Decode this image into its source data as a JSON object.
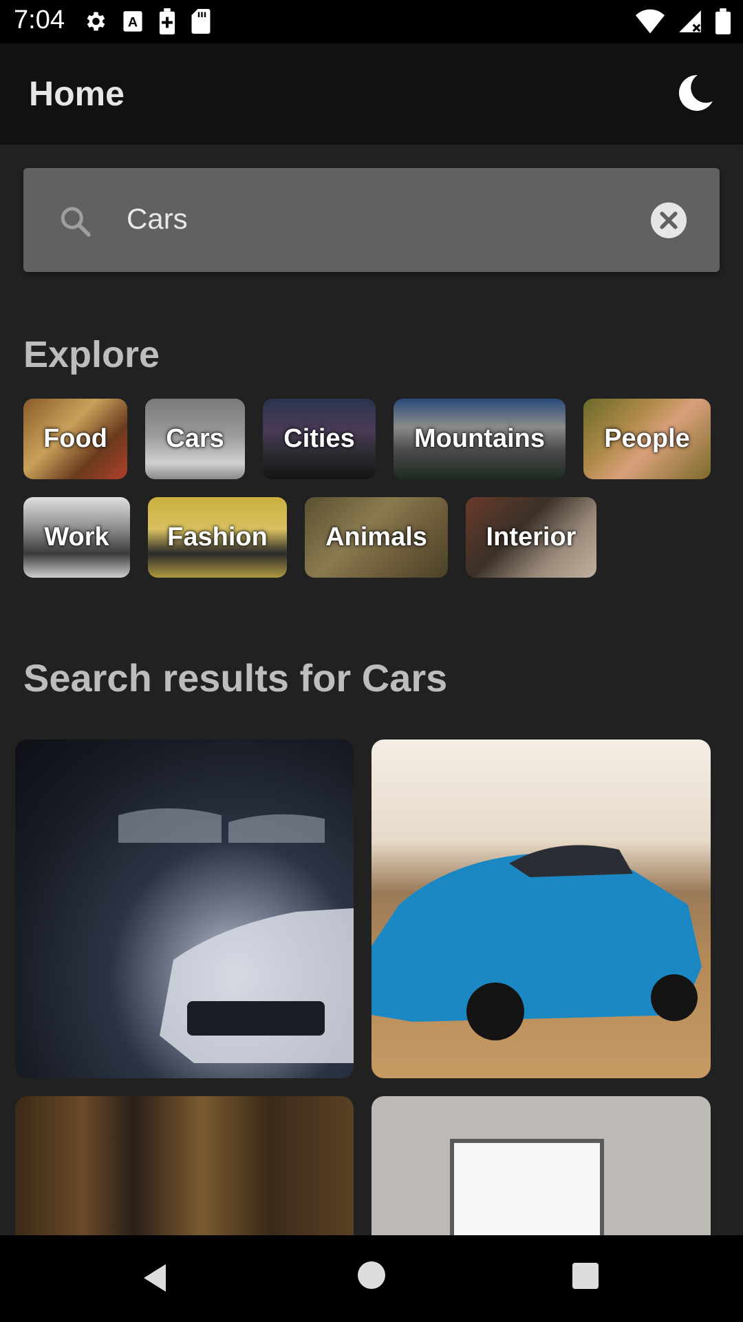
{
  "status_bar": {
    "time": "7:04",
    "left_icons": [
      "gear-icon",
      "accessibility-a-icon",
      "battery-saver-icon",
      "sd-card-icon"
    ],
    "right_icons": [
      "wifi-icon",
      "signal-no-data-icon",
      "battery-icon"
    ]
  },
  "app_bar": {
    "title": "Home",
    "theme_toggle_icon": "moon-icon"
  },
  "search": {
    "value": "Cars",
    "search_icon": "search-icon",
    "clear_icon": "clear-icon"
  },
  "explore": {
    "title": "Explore",
    "categories": [
      "Food",
      "Cars",
      "Cities",
      "Mountains",
      "People",
      "Work",
      "Fashion",
      "Animals",
      "Interior"
    ]
  },
  "results": {
    "title": "Search results for Cars"
  },
  "nav_bar": {
    "icons": [
      "back-icon",
      "home-icon",
      "recents-icon"
    ]
  }
}
